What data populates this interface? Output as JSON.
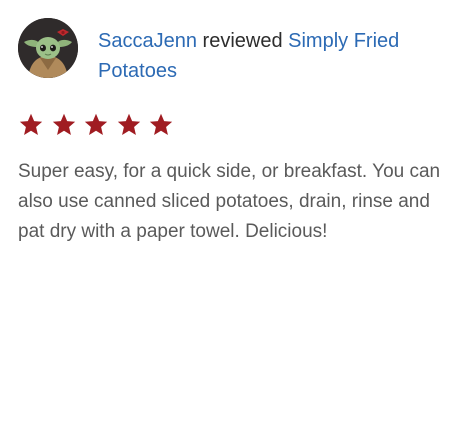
{
  "review": {
    "author": "SaccaJenn",
    "action": "reviewed",
    "recipe": "Simply Fried Potatoes",
    "rating": 5,
    "rating_max": 5,
    "text": "Super easy, for a quick side, or breakfast. You can also use canned sliced potatoes, drain, rinse and pat dry with a paper towel. Delicious!"
  },
  "icons": {
    "avatar": "baby-yoda-avatar-icon",
    "star": "star-icon"
  },
  "colors": {
    "link": "#2c6ab4",
    "star": "#a01c22",
    "body_text": "#5a5a5a",
    "heading_text": "#2d2d2d"
  }
}
